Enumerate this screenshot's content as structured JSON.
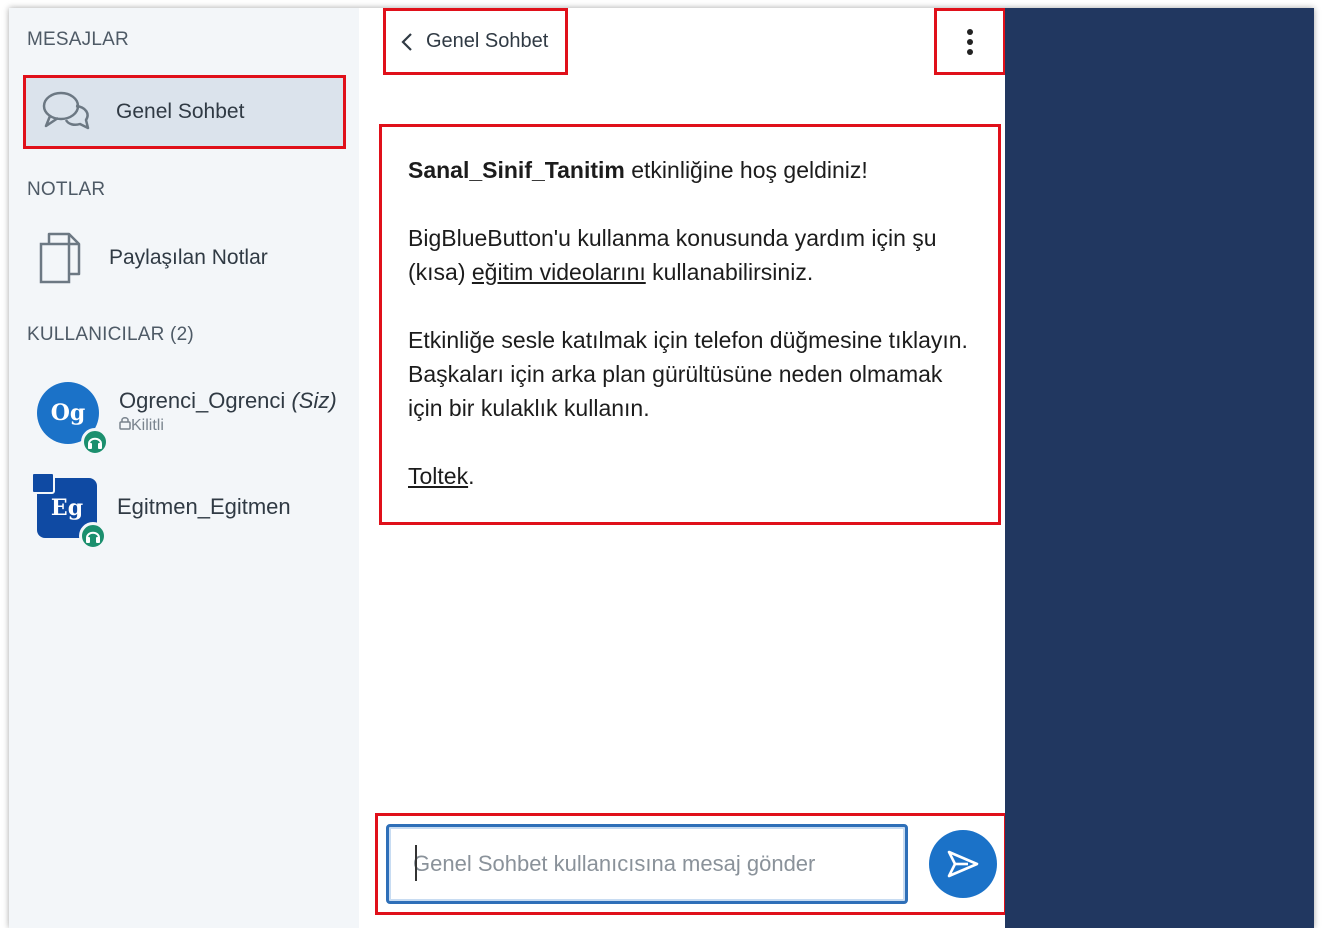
{
  "sidebar": {
    "messages_title": "MESAJLAR",
    "chat_item_label": "Genel Sohbet",
    "notes_title": "NOTLAR",
    "notes_item_label": "Paylaşılan Notlar",
    "users_title": "KULLANICILAR (2)",
    "users": [
      {
        "initials": "Og",
        "name": "Ogrenci_Ogrenci",
        "self_tag": "(Siz)",
        "sub": "Kilitli"
      },
      {
        "initials": "Eg",
        "name": "Egitmen_Egitmen"
      }
    ]
  },
  "chat": {
    "title": "Genel Sohbet",
    "welcome": {
      "event_name": "Sanal_Sinif_Tanitim",
      "line1_rest": " etkinliğine hoş geldiniz!",
      "p2_a": "BigBlueButton'u kullanma konusunda yardım için şu (kısa) ",
      "p2_link": "eğitim videolarını",
      "p2_b": " kullanabilirsiniz.",
      "p3": "Etkinliğe sesle katılmak için telefon düğmesine tıklayın. Başkaları için arka plan gürültüsüne neden olmamak için bir kulaklık kullanın.",
      "sign_link": "Toltek",
      "sign_end": "."
    },
    "input_placeholder": "Genel Sohbet kullanıcısına mesaj gönder"
  },
  "colors": {
    "highlight": "#e0101a",
    "accent": "#1b72c8",
    "right_panel": "#213760"
  },
  "icons": [
    "chat-bubbles-icon",
    "document-icon",
    "chevron-left-icon",
    "more-vertical-icon",
    "send-icon",
    "headset-icon",
    "lock-icon",
    "presenter-icon"
  ]
}
